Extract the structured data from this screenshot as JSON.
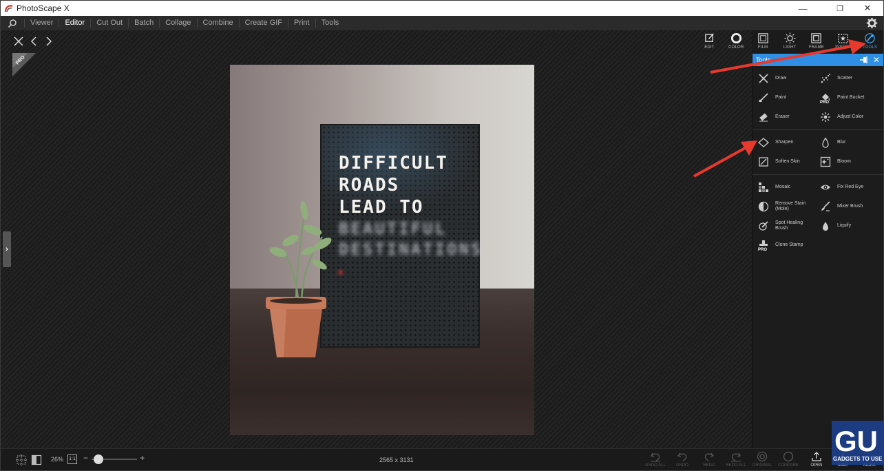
{
  "window": {
    "title": "PhotoScape X",
    "minimize": "—",
    "maximize": "❐",
    "close": "✕"
  },
  "menu": {
    "items": [
      {
        "label": "Viewer",
        "active": false
      },
      {
        "label": "Editor",
        "active": true
      },
      {
        "label": "Cut Out",
        "active": false
      },
      {
        "label": "Batch",
        "active": false
      },
      {
        "label": "Collage",
        "active": false
      },
      {
        "label": "Combine",
        "active": false
      },
      {
        "label": "Create GIF",
        "active": false
      },
      {
        "label": "Print",
        "active": false
      },
      {
        "label": "Tools",
        "active": false
      }
    ]
  },
  "editor_nav": {
    "pro_badge": "PRO"
  },
  "photo": {
    "board_lines": [
      "DIFFICULT",
      "ROADS",
      "LEAD TO"
    ],
    "board_blurred": [
      "BEAUTIFUL",
      "DESTINATIONS"
    ]
  },
  "top_tools": [
    {
      "label": "EDIT",
      "icon": "edit-icon",
      "active": false
    },
    {
      "label": "COLOR",
      "icon": "color-icon",
      "active": false
    },
    {
      "label": "FILM",
      "icon": "film-icon",
      "active": false
    },
    {
      "label": "LIGHT",
      "icon": "light-icon",
      "active": false
    },
    {
      "label": "FRAME",
      "icon": "frame-icon",
      "active": false
    },
    {
      "label": "INSERT",
      "icon": "insert-icon",
      "active": false
    },
    {
      "label": "TOOLS",
      "icon": "tools-icon",
      "active": true
    }
  ],
  "panel": {
    "title": "Tools",
    "groups": [
      [
        {
          "label": "Draw",
          "icon": "draw-icon"
        },
        {
          "label": "Scatter",
          "icon": "scatter-icon"
        },
        {
          "label": "Paint",
          "icon": "paint-icon"
        },
        {
          "label": "Paint Bucket",
          "icon": "paint-bucket-icon"
        },
        {
          "label": "Eraser",
          "icon": "eraser-icon"
        },
        {
          "label": "Adjust Color",
          "icon": "adjust-color-icon"
        }
      ],
      [
        {
          "label": "Sharpen",
          "icon": "sharpen-icon"
        },
        {
          "label": "Blur",
          "icon": "blur-icon"
        },
        {
          "label": "Soften Skin",
          "icon": "soften-skin-icon"
        },
        {
          "label": "Bloom",
          "icon": "bloom-icon"
        }
      ],
      [
        {
          "label": "Mosaic",
          "icon": "mosaic-icon"
        },
        {
          "label": "Fix Red Eye",
          "icon": "fix-red-eye-icon"
        },
        {
          "label": "Remove Stain (Mole)",
          "icon": "remove-stain-icon"
        },
        {
          "label": "Mixer Brush",
          "icon": "mixer-brush-icon"
        },
        {
          "label": "Spot Healing Brush",
          "icon": "spot-healing-icon"
        },
        {
          "label": "Liquify",
          "icon": "liquify-icon"
        },
        {
          "label": "Clone Stamp",
          "icon": "clone-stamp-icon"
        }
      ]
    ]
  },
  "bottom": {
    "zoom_percent": "26%",
    "zoom_one_to_one": "1:1",
    "zoom_minus": "−",
    "zoom_plus": "+",
    "zoom_level": 0.15,
    "dimensions": "2565 x 3131",
    "actions": [
      {
        "label": "UNDO ALL",
        "icon": "undo-all-icon",
        "lit": false
      },
      {
        "label": "UNDO",
        "icon": "undo-icon",
        "lit": false
      },
      {
        "label": "REDO",
        "icon": "redo-icon",
        "lit": false
      },
      {
        "label": "REDO ALL",
        "icon": "redo-all-icon",
        "lit": false
      },
      {
        "label": "ORIGINAL",
        "icon": "original-icon",
        "lit": false
      },
      {
        "label": "COMPARE",
        "icon": "compare-icon",
        "lit": false
      },
      {
        "label": "OPEN",
        "icon": "open-icon",
        "lit": true
      },
      {
        "label": "SAVE",
        "icon": "save-icon",
        "lit": true
      },
      {
        "label": "MORE",
        "icon": "more-icon",
        "lit": true
      }
    ]
  },
  "watermark": {
    "text": "GADGETS TO USE"
  },
  "colors": {
    "accent": "#2f8fe4",
    "annotation_arrow": "#e8392e"
  }
}
